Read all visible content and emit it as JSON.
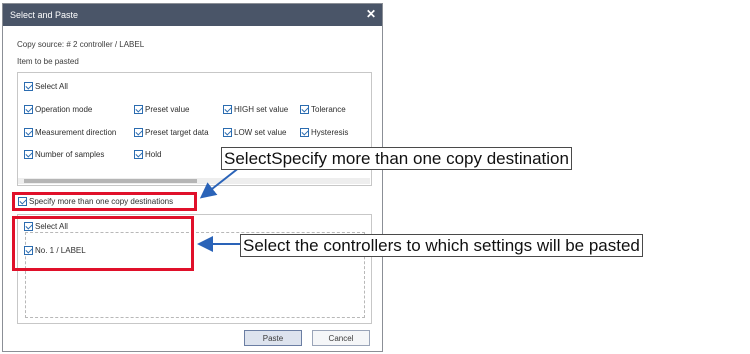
{
  "dialog": {
    "title": "Select and Paste",
    "close_glyph": "✕",
    "copy_source": "Copy source: # 2 controller /  LABEL",
    "item_heading": "Item to be pasted"
  },
  "items": {
    "select_all": "Select All",
    "options": [
      "Operation mode",
      "Preset value",
      "HIGH set value",
      "Tolerance",
      "Measurement direction",
      "Preset target data",
      "LOW set value",
      "Hysteresis",
      "Number of samples",
      "Hold"
    ]
  },
  "destination": {
    "multi_label": "Specify more than one copy destinations",
    "select_all": "Select All",
    "controllers": [
      "No. 1 /  LABEL"
    ]
  },
  "buttons": {
    "paste": "Paste",
    "cancel": "Cancel"
  },
  "annotations": {
    "callout_1": "SelectSpecify more than one copy destination",
    "callout_2": "Select the controllers to which settings will be pasted"
  },
  "colors": {
    "titlebar": "#4a5568",
    "checkbox": "#2b6cb0",
    "highlight": "#e0102a",
    "arrow": "#2a63b8"
  }
}
